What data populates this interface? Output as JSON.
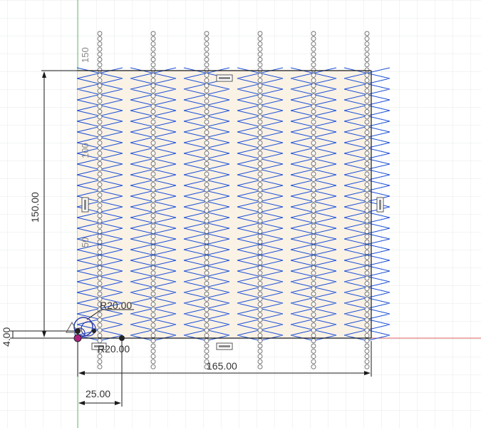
{
  "dimensions": {
    "height": "150.00",
    "width": "165.00",
    "offset_small": "4.00",
    "offset_x": "25.00",
    "radius_top": "R20.00",
    "radius_bottom": "R20.00"
  },
  "axis_labels": {
    "y_150": "150",
    "y_100": "100",
    "y_50": "50"
  },
  "colors": {
    "grid": "#e4e8ea",
    "zigzag": "#1a4fd6",
    "fill": "#fbf2e6",
    "circle": "#6a6a6a",
    "dimension": "#1a1a1a",
    "x_axis": "#e06060",
    "y_axis": "#5cbf5c"
  }
}
